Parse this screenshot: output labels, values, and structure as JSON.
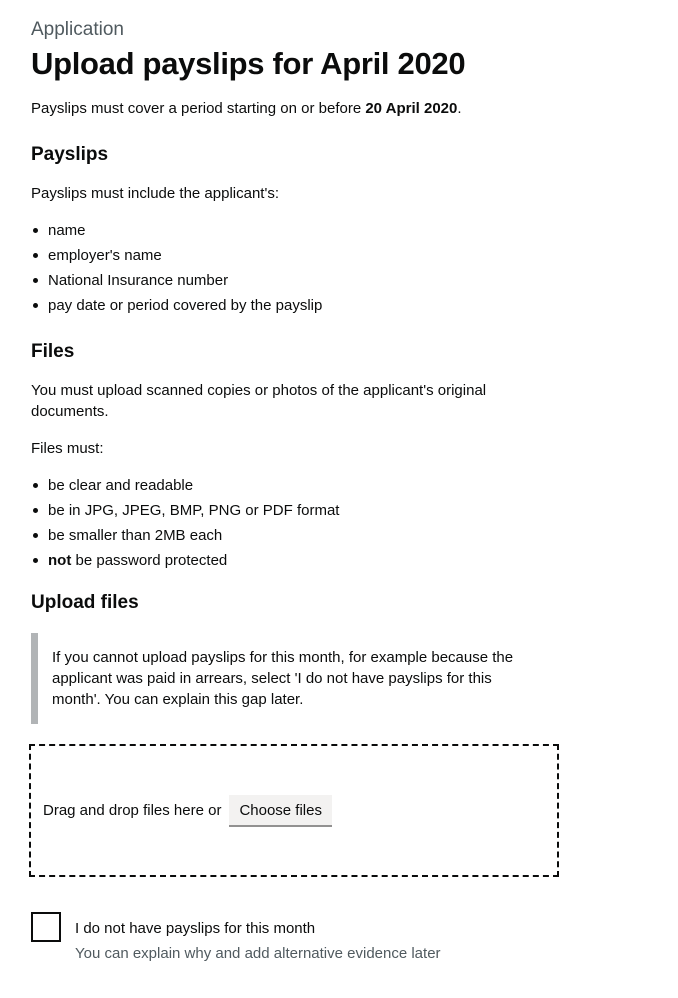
{
  "header": {
    "caption": "Application",
    "title": "Upload payslips for April 2020"
  },
  "intro": {
    "text_before": "Payslips must cover a period starting on or before ",
    "date_bold": "20 April 2020",
    "text_after": "."
  },
  "payslips_section": {
    "heading": "Payslips",
    "lead": "Payslips must include the applicant's:",
    "items": [
      "name",
      "employer's name",
      "National Insurance number",
      "pay date or period covered by the payslip"
    ]
  },
  "files_section": {
    "heading": "Files",
    "lead": "You must upload scanned copies or photos of the applicant's original documents.",
    "must_label": "Files must:",
    "items": [
      "be clear and readable",
      "be in JPG, JPEG, BMP, PNG or PDF format",
      "be smaller than 2MB each"
    ],
    "last_item_bold": "not",
    "last_item_rest": " be password protected"
  },
  "upload_section": {
    "heading": "Upload files",
    "inset_text": "If you cannot upload payslips for this month, for example because the applicant was paid in arrears, select 'I do not have payslips for this month'. You can explain this gap later.",
    "dropzone_text": "Drag and drop files here or",
    "choose_button_label": "Choose files"
  },
  "no_payslips_option": {
    "label": "I do not have payslips for this month",
    "hint": "You can explain why and add alternative evidence later",
    "checked": false
  }
}
